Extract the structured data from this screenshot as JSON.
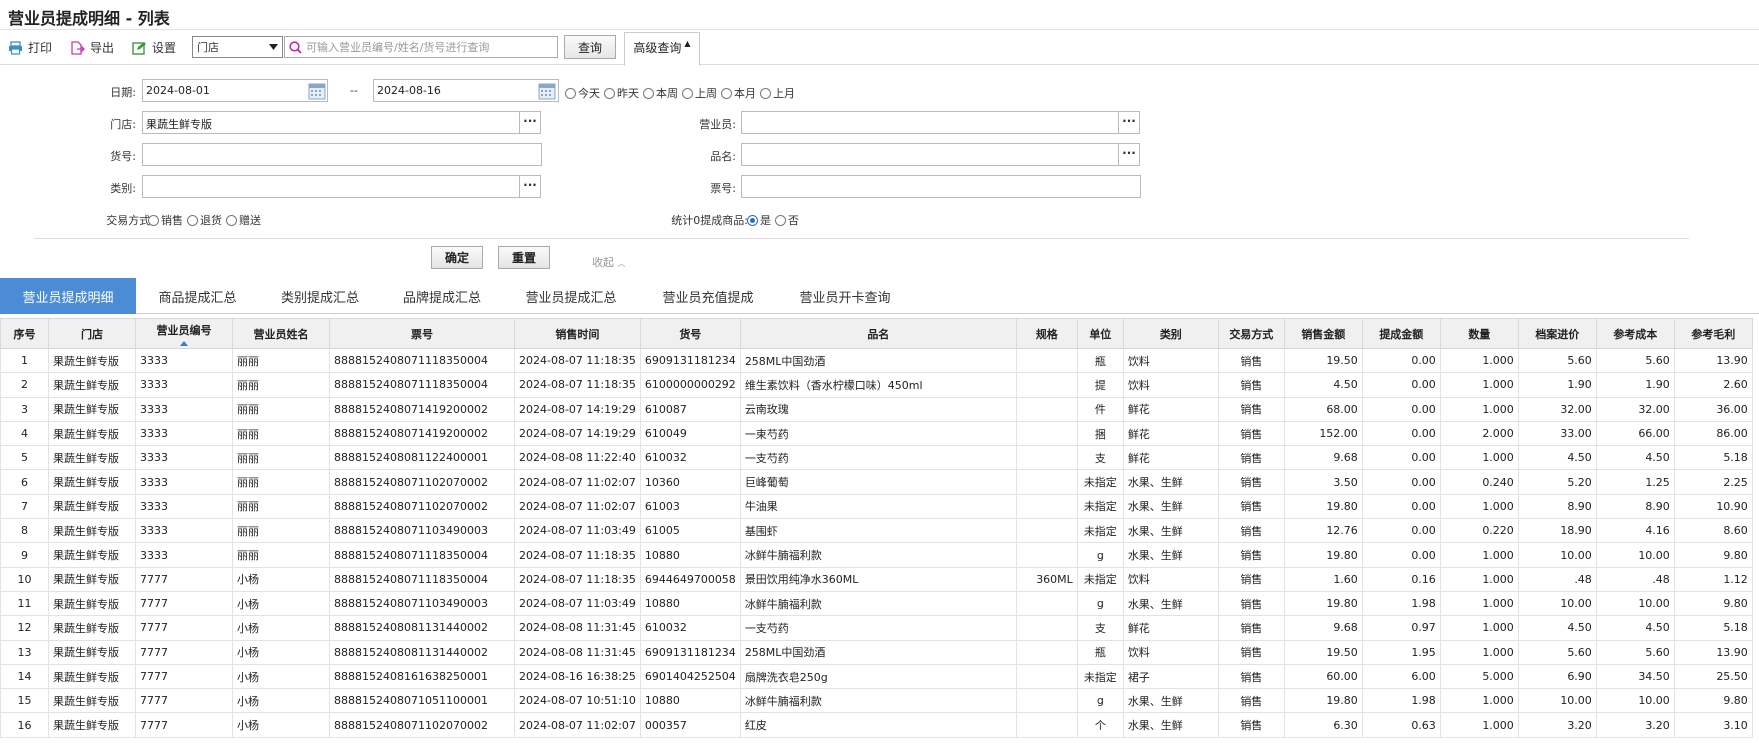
{
  "page_title": "营业员提成明细 - 列表",
  "toolbar": {
    "print_label": "打印",
    "export_label": "导出",
    "settings_label": "设置",
    "store_select_value": "门店",
    "search_placeholder": "可输入营业员编号/姓名/货号进行查询",
    "query_label": "查询",
    "advanced_label": "高级查询"
  },
  "filters": {
    "date_label": "日期:",
    "date_from": "2024-08-01",
    "date_sep": "--",
    "date_to": "2024-08-16",
    "quick_dates": [
      "今天",
      "昨天",
      "本周",
      "上周",
      "本月",
      "上月"
    ],
    "store_label": "门店:",
    "store_value": "果蔬生鲜专版",
    "clerk_label": "营业员:",
    "clerk_value": "",
    "item_no_label": "货号:",
    "item_no_value": "",
    "product_name_label": "品名:",
    "product_name_value": "",
    "category_label": "类别:",
    "category_value": "",
    "ticket_label": "票号:",
    "ticket_value": "",
    "trade_type_label": "交易方式:",
    "trade_types": [
      "销售",
      "退货",
      "赠送"
    ],
    "zero_commission_label": "统计0提成商品:",
    "zero_options": [
      "是",
      "否"
    ],
    "zero_selected": "是",
    "confirm_label": "确定",
    "reset_label": "重置",
    "collapse_label": "收起"
  },
  "tabs": [
    "营业员提成明细",
    "商品提成汇总",
    "类别提成汇总",
    "品牌提成汇总",
    "营业员提成汇总",
    "营业员充值提成",
    "营业员开卡查询"
  ],
  "table": {
    "headers": [
      "序号",
      "门店",
      "营业员编号",
      "营业员姓名",
      "票号",
      "销售时间",
      "货号",
      "品名",
      "规格",
      "单位",
      "类别",
      "交易方式",
      "销售金额",
      "提成金额",
      "数量",
      "档案进价",
      "参考成本",
      "参考毛利"
    ],
    "rows": [
      [
        "1",
        "果蔬生鲜专版",
        "3333",
        "丽丽",
        "8888152408071118350004",
        "2024-08-07 11:18:35",
        "6909131181234",
        "258ML中国劲酒",
        "",
        "瓶",
        "饮料",
        "销售",
        "19.50",
        "0.00",
        "1.000",
        "5.60",
        "5.60",
        "13.90"
      ],
      [
        "2",
        "果蔬生鲜专版",
        "3333",
        "丽丽",
        "8888152408071118350004",
        "2024-08-07 11:18:35",
        "6100000000292",
        "维生素饮料（香水柠檬口味）450ml",
        "",
        "提",
        "饮料",
        "销售",
        "4.50",
        "0.00",
        "1.000",
        "1.90",
        "1.90",
        "2.60"
      ],
      [
        "3",
        "果蔬生鲜专版",
        "3333",
        "丽丽",
        "8888152408071419200002",
        "2024-08-07 14:19:29",
        "610087",
        "云南玫瑰",
        "",
        "件",
        "鲜花",
        "销售",
        "68.00",
        "0.00",
        "1.000",
        "32.00",
        "32.00",
        "36.00"
      ],
      [
        "4",
        "果蔬生鲜专版",
        "3333",
        "丽丽",
        "8888152408071419200002",
        "2024-08-07 14:19:29",
        "610049",
        "一束芍药",
        "",
        "捆",
        "鲜花",
        "销售",
        "152.00",
        "0.00",
        "2.000",
        "33.00",
        "66.00",
        "86.00"
      ],
      [
        "5",
        "果蔬生鲜专版",
        "3333",
        "丽丽",
        "8888152408081122400001",
        "2024-08-08 11:22:40",
        "610032",
        "一支芍药",
        "",
        "支",
        "鲜花",
        "销售",
        "9.68",
        "0.00",
        "1.000",
        "4.50",
        "4.50",
        "5.18"
      ],
      [
        "6",
        "果蔬生鲜专版",
        "3333",
        "丽丽",
        "8888152408071102070002",
        "2024-08-07 11:02:07",
        "10360",
        "巨峰葡萄",
        "",
        "未指定",
        "水果、生鲜",
        "销售",
        "3.50",
        "0.00",
        "0.240",
        "5.20",
        "1.25",
        "2.25"
      ],
      [
        "7",
        "果蔬生鲜专版",
        "3333",
        "丽丽",
        "8888152408071102070002",
        "2024-08-07 11:02:07",
        "61003",
        "牛油果",
        "",
        "未指定",
        "水果、生鲜",
        "销售",
        "19.80",
        "0.00",
        "1.000",
        "8.90",
        "8.90",
        "10.90"
      ],
      [
        "8",
        "果蔬生鲜专版",
        "3333",
        "丽丽",
        "8888152408071103490003",
        "2024-08-07 11:03:49",
        "61005",
        "基围虾",
        "",
        "未指定",
        "水果、生鲜",
        "销售",
        "12.76",
        "0.00",
        "0.220",
        "18.90",
        "4.16",
        "8.60"
      ],
      [
        "9",
        "果蔬生鲜专版",
        "3333",
        "丽丽",
        "8888152408071118350004",
        "2024-08-07 11:18:35",
        "10880",
        "冰鲜牛腩福利款",
        "",
        "g",
        "水果、生鲜",
        "销售",
        "19.80",
        "0.00",
        "1.000",
        "10.00",
        "10.00",
        "9.80"
      ],
      [
        "10",
        "果蔬生鲜专版",
        "7777",
        "小杨",
        "8888152408071118350004",
        "2024-08-07 11:18:35",
        "6944649700058",
        "景田饮用纯净水360ML",
        "360ML",
        "未指定",
        "饮料",
        "销售",
        "1.60",
        "0.16",
        "1.000",
        ".48",
        ".48",
        "1.12"
      ],
      [
        "11",
        "果蔬生鲜专版",
        "7777",
        "小杨",
        "8888152408071103490003",
        "2024-08-07 11:03:49",
        "10880",
        "冰鲜牛腩福利款",
        "",
        "g",
        "水果、生鲜",
        "销售",
        "19.80",
        "1.98",
        "1.000",
        "10.00",
        "10.00",
        "9.80"
      ],
      [
        "12",
        "果蔬生鲜专版",
        "7777",
        "小杨",
        "8888152408081131440002",
        "2024-08-08 11:31:45",
        "610032",
        "一支芍药",
        "",
        "支",
        "鲜花",
        "销售",
        "9.68",
        "0.97",
        "1.000",
        "4.50",
        "4.50",
        "5.18"
      ],
      [
        "13",
        "果蔬生鲜专版",
        "7777",
        "小杨",
        "8888152408081131440002",
        "2024-08-08 11:31:45",
        "6909131181234",
        "258ML中国劲酒",
        "",
        "瓶",
        "饮料",
        "销售",
        "19.50",
        "1.95",
        "1.000",
        "5.60",
        "5.60",
        "13.90"
      ],
      [
        "14",
        "果蔬生鲜专版",
        "7777",
        "小杨",
        "8888152408161638250001",
        "2024-08-16 16:38:25",
        "6901404252504",
        "扇牌洗衣皂250g",
        "",
        "未指定",
        "裙子",
        "销售",
        "60.00",
        "6.00",
        "5.000",
        "6.90",
        "34.50",
        "25.50"
      ],
      [
        "15",
        "果蔬生鲜专版",
        "7777",
        "小杨",
        "8888152408071051100001",
        "2024-08-07 10:51:10",
        "10880",
        "冰鲜牛腩福利款",
        "",
        "g",
        "水果、生鲜",
        "销售",
        "19.80",
        "1.98",
        "1.000",
        "10.00",
        "10.00",
        "9.80"
      ],
      [
        "16",
        "果蔬生鲜专版",
        "7777",
        "小杨",
        "8888152408071102070002",
        "2024-08-07 11:02:07",
        "000357",
        "红皮",
        "",
        "个",
        "水果、生鲜",
        "销售",
        "6.30",
        "0.63",
        "1.000",
        "3.20",
        "3.20",
        "3.10"
      ]
    ]
  }
}
